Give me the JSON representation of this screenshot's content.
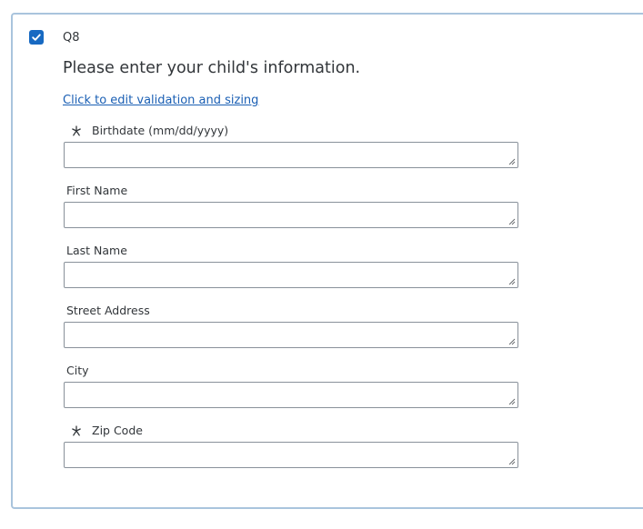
{
  "question": {
    "checked": true,
    "number": "Q8",
    "text": "Please enter your child's information.",
    "edit_link": "Click to edit validation and sizing"
  },
  "fields": [
    {
      "label": "Birthdate (mm/dd/yyyy)",
      "required": true,
      "value": ""
    },
    {
      "label": "First Name",
      "required": false,
      "value": ""
    },
    {
      "label": "Last Name",
      "required": false,
      "value": ""
    },
    {
      "label": "Street Address",
      "required": false,
      "value": ""
    },
    {
      "label": "City",
      "required": false,
      "value": ""
    },
    {
      "label": "Zip Code",
      "required": true,
      "value": ""
    }
  ],
  "icons": {
    "checkbox": "checkmark-icon",
    "required": "asterisk-icon",
    "resize": "resize-grip-icon"
  },
  "colors": {
    "accent": "#1769c2",
    "link": "#1a5fb4",
    "card_border": "#a9c4dd"
  }
}
